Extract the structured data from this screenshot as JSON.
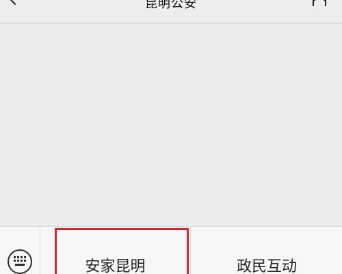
{
  "header": {
    "title": "昆明公安",
    "back_icon": "chevron-left-icon",
    "profile_icon": "person-icon"
  },
  "menu": {
    "keyboard_icon": "keyboard-icon",
    "items": [
      {
        "label": "安家昆明"
      },
      {
        "label": "政民互动"
      }
    ]
  },
  "annotation": {
    "color": "#d9262c"
  }
}
